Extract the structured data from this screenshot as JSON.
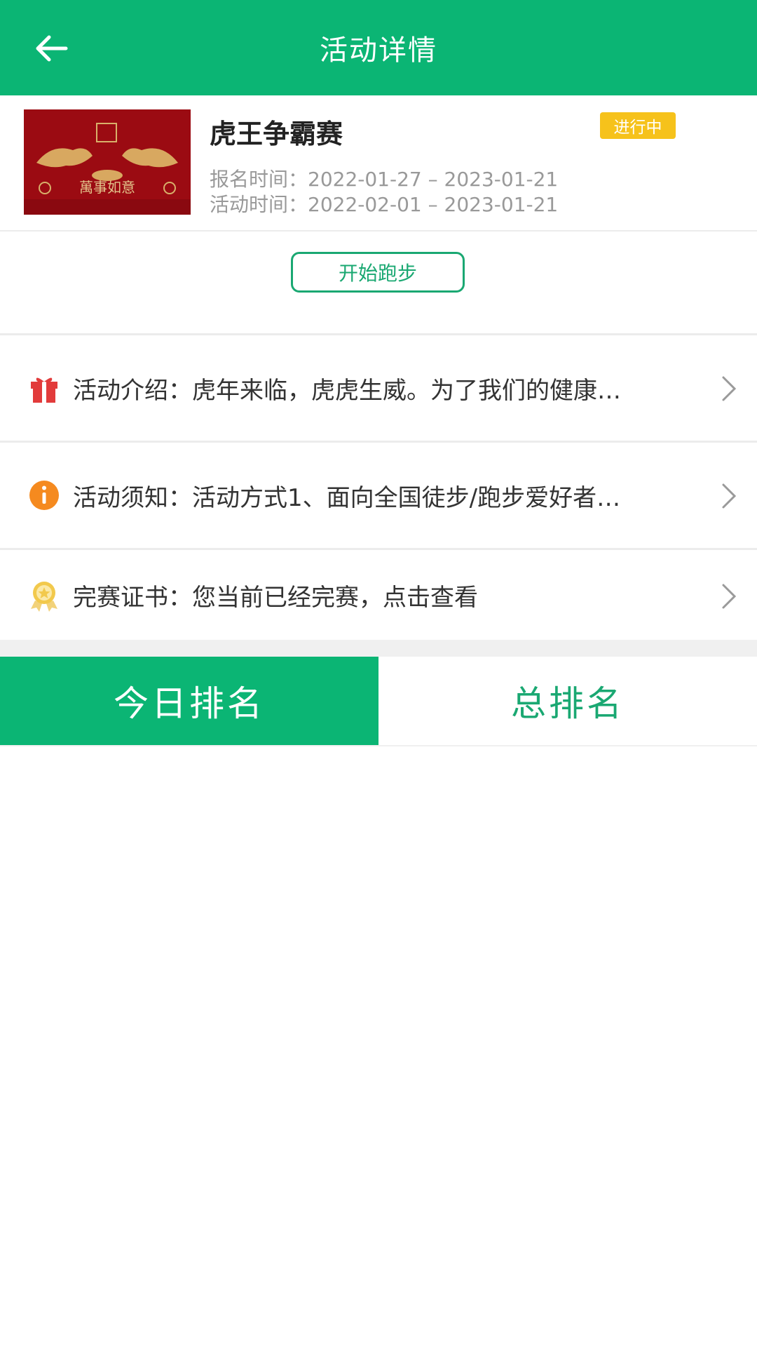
{
  "header": {
    "title": "活动详情"
  },
  "event": {
    "name": "虎王争霸赛",
    "status": "进行中",
    "signup_time": "报名时间：2022-01-27 – 2023-01-21",
    "activity_time": "活动时间：2022-02-01 – 2023-01-21",
    "poster_text": "萬事如意",
    "action_label": "开始跑步"
  },
  "info_rows": [
    {
      "icon": "gift-icon",
      "text": "活动介绍：虎年来临，虎虎生威。为了我们的健康…"
    },
    {
      "icon": "info-icon",
      "text": "活动须知：活动方式1、面向全国徒步/跑步爱好者…"
    },
    {
      "icon": "medal-icon",
      "text": "完赛证书：您当前已经完赛，点击查看"
    }
  ],
  "tabs": {
    "today": "今日排名",
    "total": "总排名"
  },
  "colors": {
    "primary": "#0bb574",
    "badge": "#f6c21b",
    "poster": "#9b0b12"
  }
}
